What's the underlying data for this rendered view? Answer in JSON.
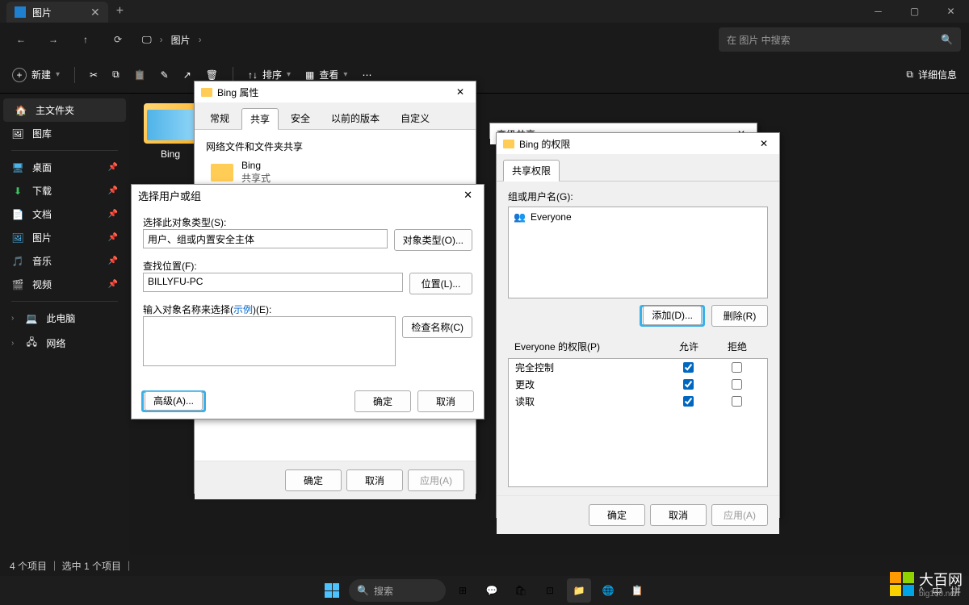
{
  "titlebar": {
    "tab_label": "图片"
  },
  "nav": {
    "breadcrumb": [
      "图片"
    ],
    "search_placeholder": "在 图片 中搜索"
  },
  "toolbar": {
    "new": "新建",
    "sort": "排序",
    "view": "查看",
    "details": "详细信息"
  },
  "sidebar": {
    "home": "主文件夹",
    "gallery": "图库",
    "desktop": "桌面",
    "downloads": "下载",
    "documents": "文档",
    "pictures": "图片",
    "music": "音乐",
    "videos": "视频",
    "thispc": "此电脑",
    "network": "网络"
  },
  "content": {
    "folder_name": "Bing"
  },
  "status": {
    "text": "4 个项目 ｜ 选中 1 个项目 ｜"
  },
  "props": {
    "title": "Bing 属性",
    "tabs": {
      "general": "常规",
      "sharing": "共享",
      "security": "安全",
      "prev": "以前的版本",
      "custom": "自定义"
    },
    "section": "网络文件和文件夹共享",
    "name": "Bing",
    "share_status": "共享式",
    "ok": "确定",
    "cancel": "取消",
    "apply": "应用(A)"
  },
  "select": {
    "title": "选择用户或组",
    "obj_type_label": "选择此对象类型(S):",
    "obj_type_value": "用户、组或内置安全主体",
    "obj_type_btn": "对象类型(O)...",
    "location_label": "查找位置(F):",
    "location_value": "BILLYFU-PC",
    "location_btn": "位置(L)...",
    "names_label_pre": "输入对象名称来选择(",
    "names_label_link": "示例",
    "names_label_post": ")(E):",
    "check_btn": "检查名称(C)",
    "advanced_btn": "高级(A)...",
    "ok": "确定",
    "cancel": "取消"
  },
  "adv": {
    "title": "高级共享"
  },
  "perm": {
    "title": "Bing 的权限",
    "tab": "共享权限",
    "group_label": "组或用户名(G):",
    "everyone": "Everyone",
    "add_btn": "添加(D)...",
    "remove_btn": "删除(R)",
    "perm_label": "Everyone 的权限(P)",
    "allow": "允许",
    "deny": "拒绝",
    "rows": [
      {
        "name": "完全控制",
        "allow": true,
        "deny": false
      },
      {
        "name": "更改",
        "allow": true,
        "deny": false
      },
      {
        "name": "读取",
        "allow": true,
        "deny": false
      }
    ],
    "ok": "确定",
    "cancel": "取消",
    "apply": "应用(A)"
  },
  "taskbar": {
    "search": "搜索",
    "tray": {
      "ime1": "中",
      "ime2": "拼"
    }
  },
  "watermark": {
    "name": "大百网",
    "url": "big100.net"
  }
}
